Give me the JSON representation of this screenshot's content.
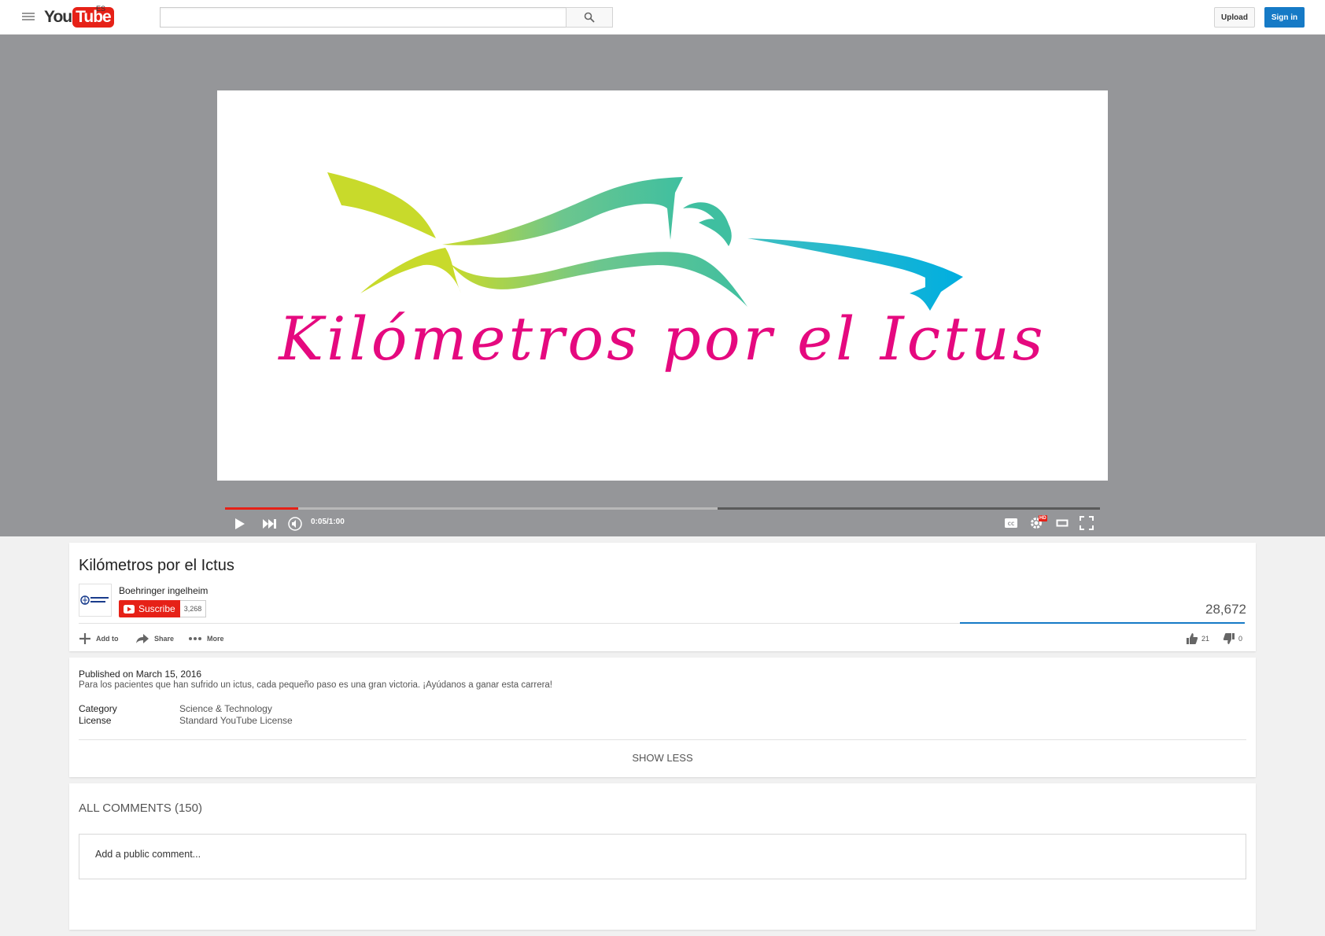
{
  "masthead": {
    "logo_you": "You",
    "logo_tube": "Tube",
    "country_code": "ES",
    "search_placeholder": "",
    "upload_label": "Upload",
    "signin_label": "Sign in"
  },
  "player": {
    "time_display": "0:05/1:00",
    "progress_played_fraction": 0.0833,
    "progress_loaded_fraction": 0.563,
    "hd_label": "HD",
    "cc_label": "CC"
  },
  "video": {
    "title": "Kilómetros por el Ictus",
    "thumbnail_text": "Kilómetros por el Ictus",
    "owner_name": "Boehringer ingelheim",
    "owner_logo_text": "Boehringer Ingelheim",
    "subscribe_label": "Suscribe",
    "subscriber_count": "3,268",
    "view_count": "28,672",
    "likes": "21",
    "dislikes": "0",
    "like_fraction": 1.0,
    "actions": {
      "add_to": "Add to",
      "share": "Share",
      "more": "More"
    }
  },
  "description": {
    "published": "Published on March 15, 2016",
    "text": "Para los pacientes que han sufrido un ictus, cada pequeño paso es una gran victoria. ¡Ayúdanos a ganar esta carrera!",
    "category_label": "Category",
    "category_value": "Science & Technology",
    "license_label": "License",
    "license_value": "Standard YouTube License",
    "show_less": "SHOW LESS"
  },
  "comments": {
    "header": "ALL COMMENTS (150)",
    "placeholder": "Add a public comment..."
  },
  "colors": {
    "accent_red": "#e62117",
    "accent_blue": "#167ac6",
    "logo_pink": "#e5097f",
    "logo_green": "#c5d92d",
    "logo_teal": "#3fbfa0",
    "logo_cyan": "#00aee0"
  }
}
